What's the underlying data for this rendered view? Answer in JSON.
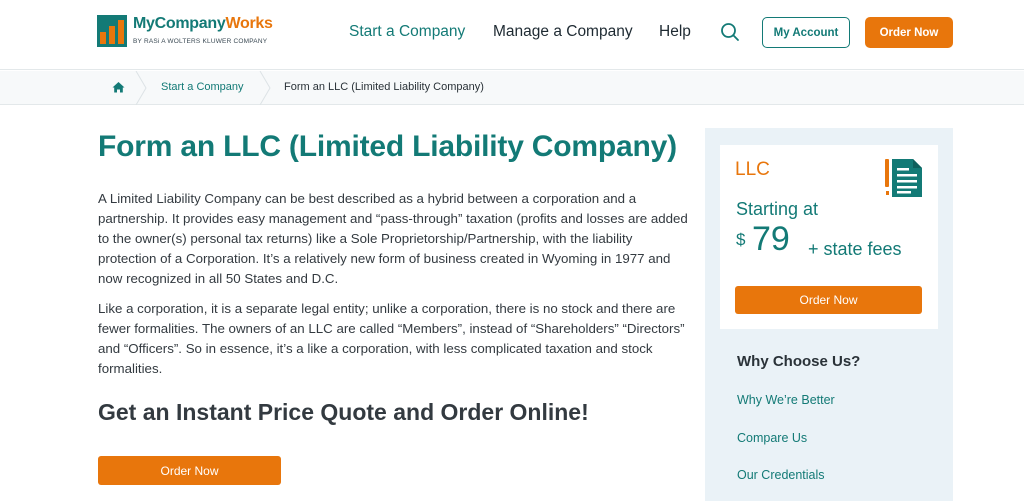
{
  "logo": {
    "name_part1": "My",
    "name_part2": "Company",
    "name_part3": "Works",
    "tagline": "BY RASi A WOLTERS KLUWER COMPANY"
  },
  "nav": {
    "start": "Start a Company",
    "manage": "Manage a Company",
    "help": "Help",
    "account": "My Account",
    "order": "Order Now"
  },
  "breadcrumb": {
    "items": [
      "Start a Company",
      "Form an LLC (Limited Liability Company)"
    ]
  },
  "main": {
    "title": "Form an LLC (Limited Liability Company)",
    "paragraph1": "A Limited Liability Company can be best described as a hybrid between a corporation and a partnership. It provides easy management and “pass-through” taxation (profits and losses are added to the owner(s) personal tax returns) like a Sole Proprietorship/Partnership, with the liability protection of a Corporation. It’s a relatively new form of business created in Wyoming in 1977 and now recognized in all 50 States and D.C.",
    "paragraph2": "Like a corporation, it is a separate legal entity; unlike a corporation, there is no stock and there are fewer formalities. The owners of an LLC are called “Members”, instead of “Shareholders” “Directors” and “Officers”. So in essence, it’s a like a corporation, with less complicated taxation and stock formalities.",
    "quote_heading": "Get an Instant Price Quote and Order Online!",
    "order_label": "Order Now"
  },
  "price_card": {
    "type": "LLC",
    "starting_label": "Starting at",
    "currency": "$",
    "amount": "79",
    "fees_label": "+ state fees",
    "order_label": "Order Now",
    "icon": "document-icon"
  },
  "why": {
    "title": "Why Choose Us?",
    "links": [
      "Why We’re Better",
      "Compare Us",
      "Our Credentials"
    ]
  },
  "colors": {
    "teal": "#137a76",
    "orange": "#e8760c",
    "sidebar_bg": "#eaf2f7"
  }
}
